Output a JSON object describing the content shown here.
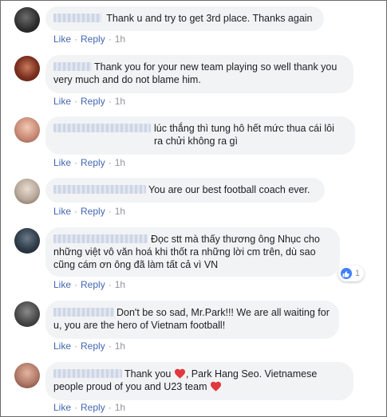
{
  "actions": {
    "like": "Like",
    "reply": "Reply",
    "separator": "·"
  },
  "comments": [
    {
      "name": "",
      "text": "Thank u and try to get 3rd place. Thanks again",
      "time": "1h",
      "avatar_color": "#3a3a3a"
    },
    {
      "name": "",
      "text": "Thank you for your new team playing so well thank you very much and do not blame him.",
      "time": "1h",
      "avatar_color": "#8a3b2a"
    },
    {
      "name": "",
      "text": "lúc thắng thì tung hô hết mức thua cái lôi ra chửi không ra gì",
      "time": "1h",
      "avatar_color": "#c98b76"
    },
    {
      "name": "",
      "text": "You are our best football coach ever.",
      "time": "1h",
      "avatar_color": "#b8a89a"
    },
    {
      "name": "",
      "text": "Đọc stt mà thấy thương ông Nhục cho những việt vô văn hoá khi thốt ra những lời cm trên, dù sao cũng cám ơn ông đã làm tất cả vì VN",
      "time": "1h",
      "avatar_color": "#2f3d4a",
      "reactions": {
        "count": "1",
        "icon": "like-icon",
        "color": "#4080ff"
      }
    },
    {
      "name": "",
      "text": "Don't be so sad, Mr.Park!!! We are all waiting for u, you are the hero of Vietnam football!",
      "time": "1h",
      "avatar_color": "#4a4a4a"
    },
    {
      "name": "",
      "text_parts": [
        "Thank you",
        ", Park Hang Seo. Vietnamese people proud of you and U23 team"
      ],
      "time": "1h",
      "avatar_color": "#b07868",
      "heart_color": "#e0393e"
    }
  ]
}
